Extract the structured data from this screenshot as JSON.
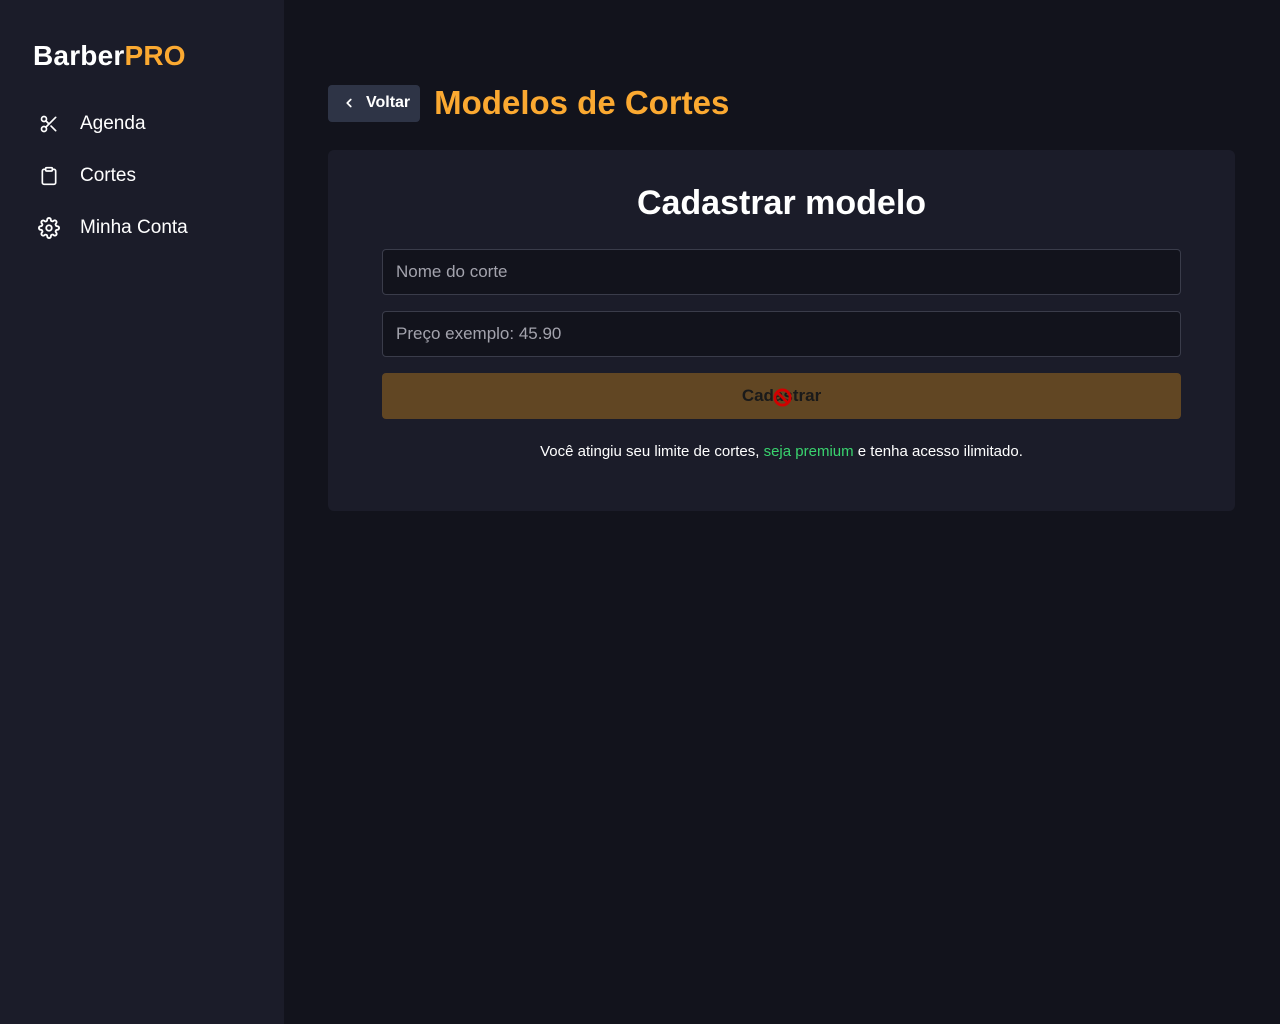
{
  "brand": {
    "part1": "Barber",
    "part2": "PRO"
  },
  "sidebar": {
    "items": [
      {
        "label": "Agenda",
        "icon": "scissors-icon"
      },
      {
        "label": "Cortes",
        "icon": "clipboard-icon"
      },
      {
        "label": "Minha Conta",
        "icon": "gear-icon"
      }
    ]
  },
  "header": {
    "back_label": "Voltar",
    "title": "Modelos de Cortes"
  },
  "form": {
    "title": "Cadastrar modelo",
    "name_placeholder": "Nome do corte",
    "price_placeholder": "Preço exemplo: 45.90",
    "submit_label": "Cadastrar",
    "limit_text_before": "Você atingiu seu limite de cortes, ",
    "limit_link": "seja premium",
    "limit_text_after": " e tenha acesso ilimitado."
  },
  "colors": {
    "accent": "#fba931",
    "sidebar_bg": "#1b1c29",
    "page_bg": "#12131c",
    "link_green": "#39d36e",
    "disabled_button": "#614623"
  }
}
